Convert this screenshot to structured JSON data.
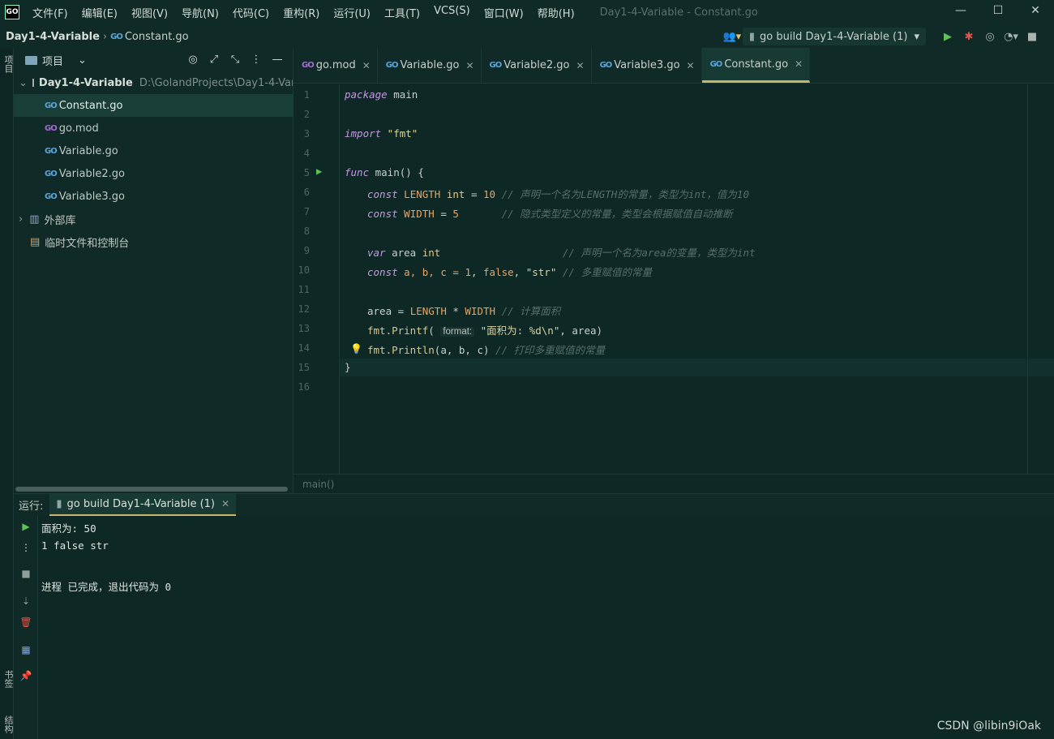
{
  "app": {
    "logo_text": "GO",
    "menu": [
      "文件(F)",
      "编辑(E)",
      "视图(V)",
      "导航(N)",
      "代码(C)",
      "重构(R)",
      "运行(U)",
      "工具(T)",
      "VCS(S)",
      "窗口(W)",
      "帮助(H)"
    ],
    "window_title": "Day1-4-Variable - Constant.go",
    "window_controls": [
      "—",
      "☐",
      "✕"
    ]
  },
  "navbar": {
    "project": "Day1-4-Variable",
    "file": "Constant.go",
    "run_config": "go build Day1-4-Variable (1)"
  },
  "left_strip": {
    "project_label": "项目",
    "bookmarks_label": "书签",
    "structure_label": "结构"
  },
  "project_panel": {
    "title": "项目",
    "root_name": "Day1-4-Variable",
    "root_path": "D:\\GolandProjects\\Day1-4-Variable",
    "files": [
      "Constant.go",
      "go.mod",
      "Variable.go",
      "Variable2.go",
      "Variable3.go"
    ],
    "external_libs": "外部库",
    "scratches": "临时文件和控制台"
  },
  "tabs": [
    {
      "label": "go.mod",
      "active": false
    },
    {
      "label": "Variable.go",
      "active": false
    },
    {
      "label": "Variable2.go",
      "active": false
    },
    {
      "label": "Variable3.go",
      "active": false
    },
    {
      "label": "Constant.go",
      "active": true
    }
  ],
  "editor": {
    "line_numbers": [
      "1",
      "2",
      "3",
      "4",
      "5",
      "6",
      "7",
      "8",
      "9",
      "10",
      "11",
      "12",
      "13",
      "14",
      "15",
      "16"
    ],
    "l1_kw": "package",
    "l1_rest": " main",
    "l3_kw": "import",
    "l3_str": " \"fmt\"",
    "l5_kw": "func",
    "l5_rest": " main() {",
    "l6_kw": "const",
    "l6_name": " LENGTH",
    "l6_type": " int",
    "l6_eq": " = ",
    "l6_num": "10",
    "l6_cm": " // 声明一个名为LENGTH的常量，类型为int，值为10",
    "l7_kw": "const",
    "l7_name": " WIDTH",
    "l7_eq": " = ",
    "l7_num": "5",
    "l7_cm": "       // 隐式类型定义的常量，类型会根据赋值自动推断",
    "l9_kw": "var",
    "l9_name": " area",
    "l9_type": " int",
    "l9_cm": "                    // 声明一个名为area的变量，类型为int",
    "l10_kw": "const",
    "l10_rest": " a, b, c = ",
    "l10_n1": "1",
    "l10_sep1": ", ",
    "l10_false": "false",
    "l10_sep2": ", ",
    "l10_str": "\"str\"",
    "l10_cm": " // 多重赋值的常量",
    "l12_pre": "area = ",
    "l12_c1": "LENGTH",
    "l12_op": " * ",
    "l12_c2": "WIDTH",
    "l12_cm": " // 计算面积",
    "l13_pkg": "fmt.",
    "l13_fn": "Printf",
    "l13_open": "( ",
    "l13_hint": "format:",
    "l13_str": " \"面积为: %d\\n\"",
    "l13_rest": ", area)",
    "l14_pkg": "fmt.",
    "l14_fn": "Println",
    "l14_rest": "(a, b, c)",
    "l14_cm": " // 打印多重赋值的常量",
    "l15": "}",
    "breadcrumb": "main()"
  },
  "run_panel": {
    "label": "运行:",
    "tab": "go build Day1-4-Variable (1)",
    "output": [
      "面积为: 50",
      "1 false str",
      "",
      "进程 已完成，退出代码为 0"
    ]
  },
  "watermark": "CSDN @libin9iOak"
}
